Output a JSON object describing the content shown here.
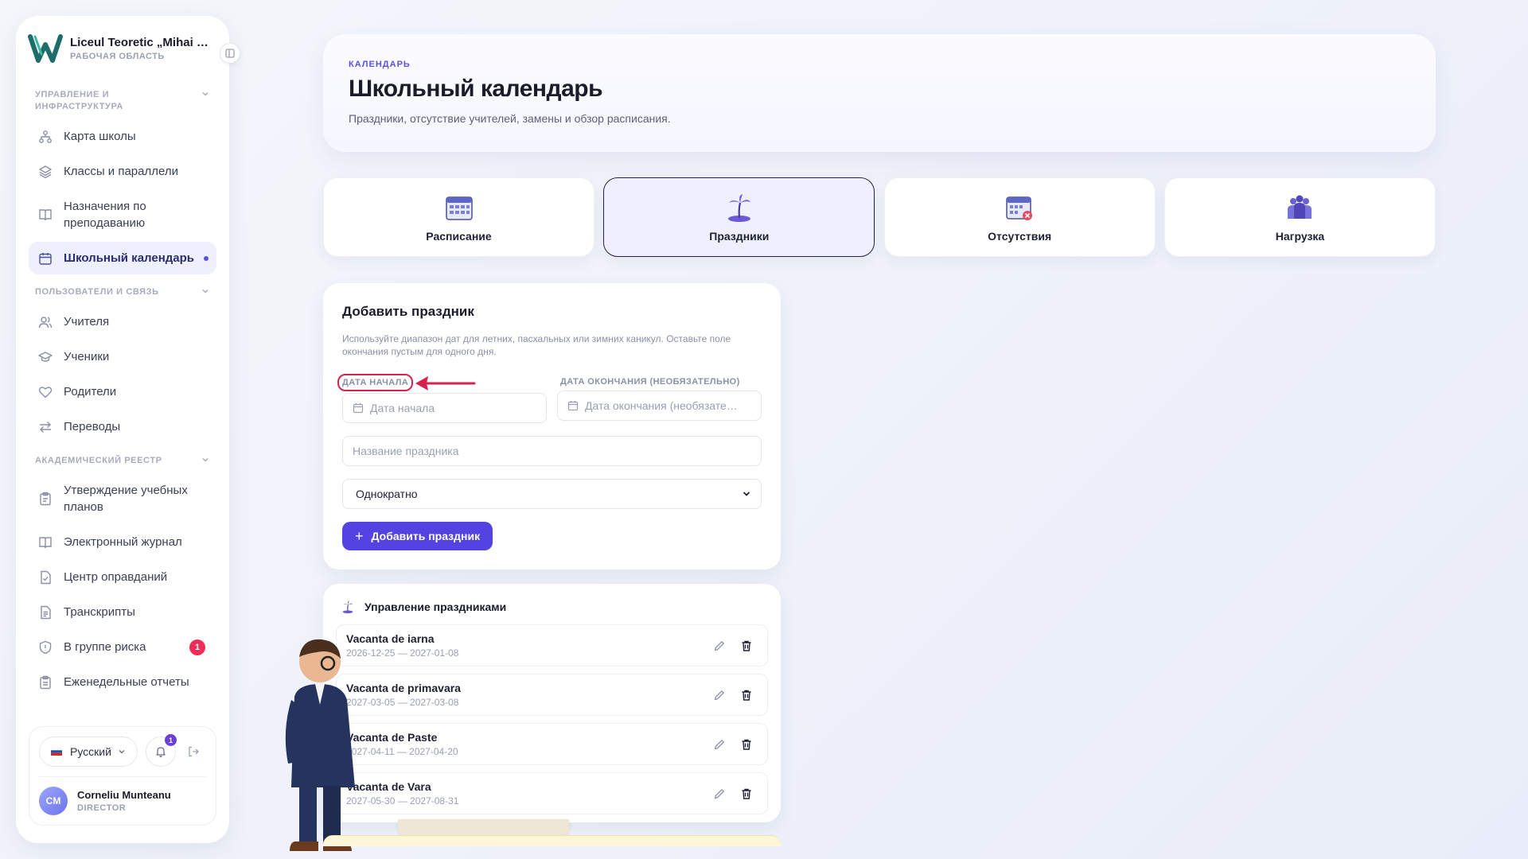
{
  "sidebar": {
    "brand_name": "Liceul Teoretic „Mihai Emi…",
    "brand_sub": "РАБОЧАЯ ОБЛАСТЬ",
    "sections": [
      {
        "title": "УПРАВЛЕНИЕ И ИНФРАСТРУКТУРА"
      },
      {
        "title": "ПОЛЬЗОВАТЕЛИ И СВЯЗЬ"
      },
      {
        "title": "АКАДЕМИЧЕСКИЙ РЕЕСТР"
      }
    ],
    "items": [
      {
        "label": "Карта школы",
        "icon": "sitemap-icon"
      },
      {
        "label": "Классы и параллели",
        "icon": "layers-icon"
      },
      {
        "label": "Назначения по преподаванию",
        "icon": "book-icon"
      },
      {
        "label": "Школьный календарь",
        "icon": "calendar-icon"
      },
      {
        "label": "Учителя",
        "icon": "users-icon"
      },
      {
        "label": "Ученики",
        "icon": "graduation-cap-icon"
      },
      {
        "label": "Родители",
        "icon": "heart-icon"
      },
      {
        "label": "Переводы",
        "icon": "arrows-swap-icon"
      },
      {
        "label": "Утверждение учебных планов",
        "icon": "clipboard-icon"
      },
      {
        "label": "Электронный журнал",
        "icon": "book-open-icon"
      },
      {
        "label": "Центр оправданий",
        "icon": "file-check-icon"
      },
      {
        "label": "Транскрипты",
        "icon": "file-text-icon"
      },
      {
        "label": "В группе риска",
        "icon": "shield-icon",
        "badge": "1"
      },
      {
        "label": "Еженедельные отчеты",
        "icon": "clipboard-list-icon"
      }
    ],
    "footer": {
      "language": "Русский",
      "notifications_count": "1",
      "user_initials": "CM",
      "user_name": "Corneliu Munteanu",
      "user_role": "DIRECTOR"
    }
  },
  "header": {
    "eyebrow": "КАЛЕНДАРЬ",
    "title": "Школьный календарь",
    "description": "Праздники, отсутствие учителей, замены и обзор расписания."
  },
  "tabs": [
    {
      "label": "Расписание",
      "icon": "schedule-icon"
    },
    {
      "label": "Праздники",
      "icon": "palm-island-icon"
    },
    {
      "label": "Отсутствия",
      "icon": "calendar-absence-icon"
    },
    {
      "label": "Нагрузка",
      "icon": "group-workload-icon"
    }
  ],
  "form": {
    "title": "Добавить праздник",
    "hint": "Используйте диапазон дат для летних, пасхальных или зимних каникул. Оставьте поле окончания пустым для одного дня.",
    "start_label": "ДАТА НАЧАЛА",
    "start_placeholder": "Дата начала",
    "end_label": "ДАТА ОКОНЧАНИЯ (НЕОБЯЗАТЕЛЬНО)",
    "end_placeholder": "Дата окончания (необязате…",
    "name_placeholder": "Название праздника",
    "recurrence_value": "Однократно",
    "submit_label": "Добавить праздник"
  },
  "holidays": {
    "title": "Управление праздниками",
    "items": [
      {
        "name": "Vacanta de iarna",
        "dates": "2026-12-25 — 2027-01-08"
      },
      {
        "name": "Vacanta de primavara",
        "dates": "2027-03-05 — 2027-03-08"
      },
      {
        "name": "Vacanta de Paste",
        "dates": "2027-04-11 — 2027-04-20"
      },
      {
        "name": "Vacanta de Vara",
        "dates": "2027-05-30 — 2027-08-31"
      }
    ]
  },
  "colors": {
    "accent": "#5343e0",
    "highlight": "#d6224f",
    "badge": "#ef2d56"
  }
}
